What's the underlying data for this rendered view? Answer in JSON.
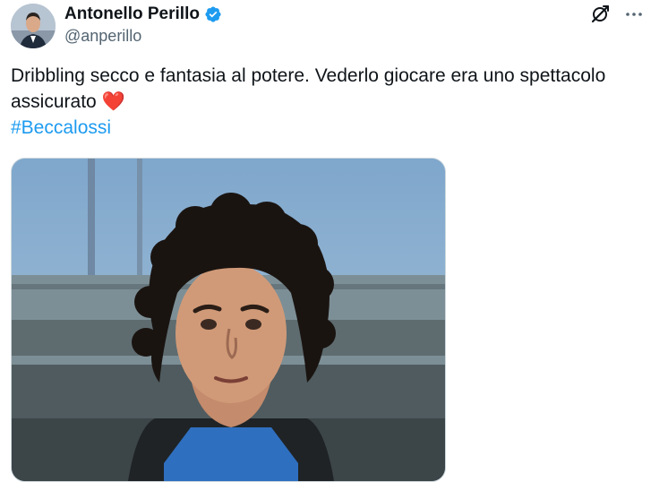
{
  "author": {
    "display_name": "Antonello Perillo",
    "handle": "@anperillo",
    "verified_icon": "verified-badge-icon"
  },
  "actions": {
    "grok_icon": "grok-icon",
    "more_icon": "more-icon",
    "more_glyph": "···"
  },
  "tweet": {
    "text": "Dribbling secco e fantasia al potere. Vederlo giocare era uno spettacolo assicurato",
    "emoji": "❤️",
    "hashtag": "#Beccalossi"
  },
  "media": {
    "type": "photo"
  },
  "colors": {
    "accent": "#1d9bf0",
    "text": "#0f1419",
    "secondary": "#536471",
    "heart": "#e0245e"
  }
}
